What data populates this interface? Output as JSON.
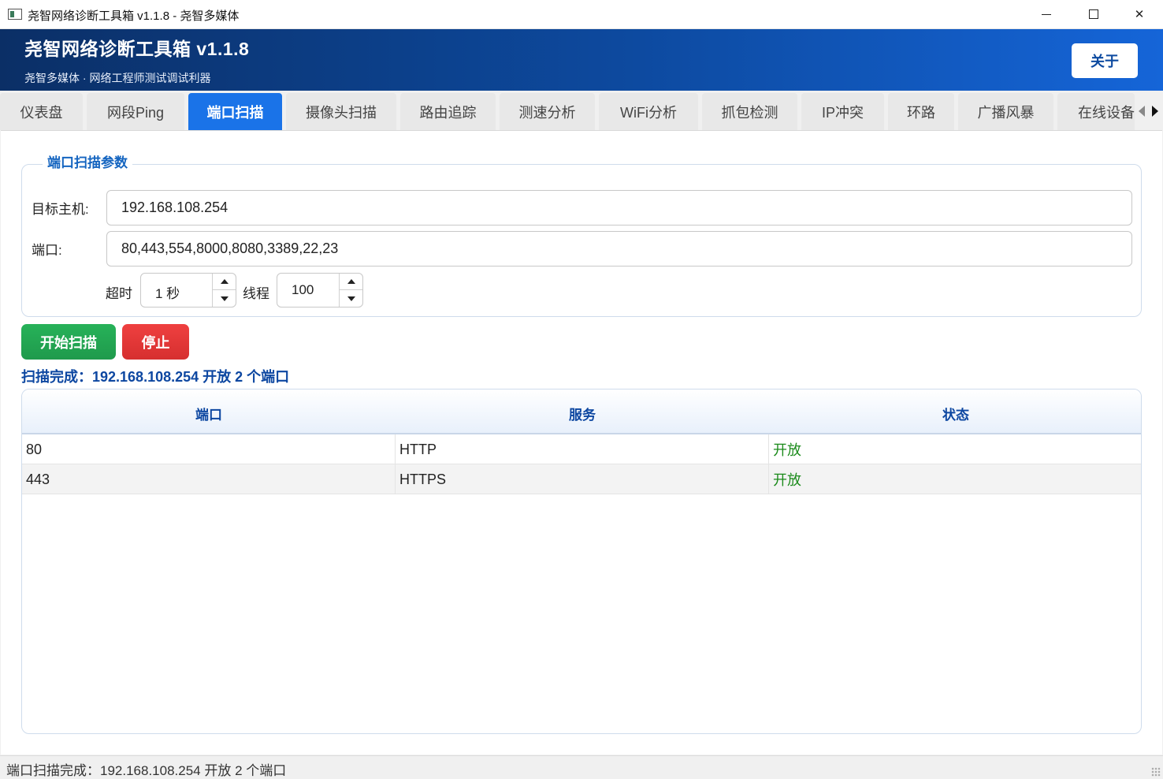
{
  "window": {
    "title": "尧智网络诊断工具箱 v1.1.8 - 尧智多媒体",
    "controls": [
      "minimize-icon",
      "maximize-icon",
      "close-icon"
    ],
    "close_glyph": "✕"
  },
  "header": {
    "title": "尧智网络诊断工具箱  v1.1.8",
    "subtitle": "尧智多媒体 · 网络工程师测试调试利器",
    "about_label": "关于"
  },
  "tabs": [
    {
      "label": "仪表盘",
      "active": false
    },
    {
      "label": "网段Ping",
      "active": false
    },
    {
      "label": "端口扫描",
      "active": true
    },
    {
      "label": "摄像头扫描",
      "active": false
    },
    {
      "label": "路由追踪",
      "active": false
    },
    {
      "label": "测速分析",
      "active": false
    },
    {
      "label": "WiFi分析",
      "active": false
    },
    {
      "label": "抓包检测",
      "active": false
    },
    {
      "label": "IP冲突",
      "active": false
    },
    {
      "label": "环路",
      "active": false
    },
    {
      "label": "广播风暴",
      "active": false
    },
    {
      "label": "在线设备",
      "active": false
    }
  ],
  "params": {
    "group_title": "端口扫描参数",
    "host_label": "目标主机:",
    "host_value": "192.168.108.254",
    "ports_label": "端口:",
    "ports_value": "80,443,554,8000,8080,3389,22,23",
    "timeout_label": "超时",
    "timeout_value": "1 秒",
    "threads_label": "线程",
    "threads_value": "100"
  },
  "actions": {
    "start_label": "开始扫描",
    "stop_label": "停止"
  },
  "scan_status": "扫描完成：192.168.108.254 开放 2 个端口",
  "results": {
    "columns": [
      "端口",
      "服务",
      "状态"
    ],
    "rows": [
      [
        "80",
        "HTTP",
        "开放"
      ],
      [
        "443",
        "HTTPS",
        "开放"
      ]
    ]
  },
  "statusbar": {
    "text": "端口扫描完成：192.168.108.254 开放 2 个端口"
  },
  "colors": {
    "accent": "#1a73e8",
    "header_dark": "#0b2f66",
    "start_green": "#1f9a4c",
    "stop_red": "#d62f2f",
    "open_status": "#1a8a1a",
    "heading_blue": "#0d47a1"
  }
}
